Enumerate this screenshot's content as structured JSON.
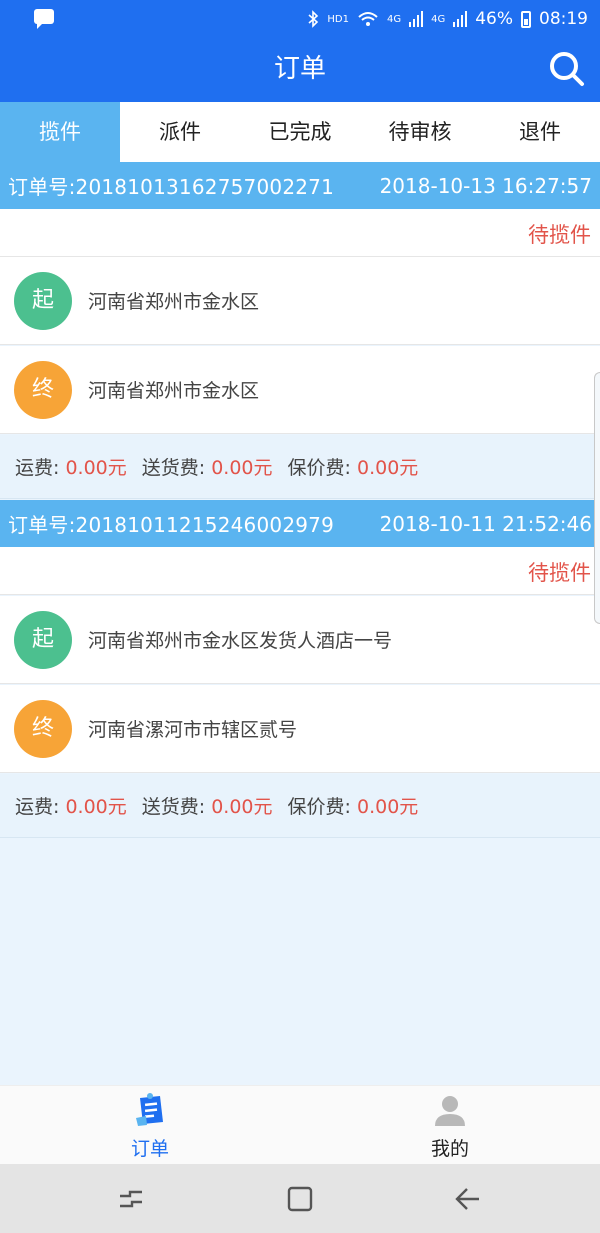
{
  "status_bar": {
    "hd": "HD1",
    "net1": "4G",
    "net2": "4G",
    "battery": "46%",
    "time": "08:19"
  },
  "header": {
    "title": "订单"
  },
  "tabs": [
    {
      "label": "揽件",
      "active": true
    },
    {
      "label": "派件",
      "active": false
    },
    {
      "label": "已完成",
      "active": false
    },
    {
      "label": "待审核",
      "active": false
    },
    {
      "label": "退件",
      "active": false
    }
  ],
  "orders": [
    {
      "number": "订单号:20181013162757002271",
      "datetime": "2018-10-13 16:27:57",
      "state": "待揽件",
      "start_badge": "起",
      "start_address": "河南省郑州市金水区",
      "end_badge": "终",
      "end_address": "河南省郑州市金水区",
      "fees": {
        "freight_label": "运费:",
        "freight_value": "0.00元",
        "delivery_label": "送货费:",
        "delivery_value": "0.00元",
        "insurance_label": "保价费:",
        "insurance_value": "0.00元"
      }
    },
    {
      "number": "订单号:20181011215246002979",
      "datetime": "2018-10-11 21:52:46",
      "state": "待揽件",
      "start_badge": "起",
      "start_address": "河南省郑州市金水区发货人酒店一号",
      "end_badge": "终",
      "end_address": "河南省漯河市市辖区贰号",
      "fees": {
        "freight_label": "运费:",
        "freight_value": "0.00元",
        "delivery_label": "送货费:",
        "delivery_value": "0.00元",
        "insurance_label": "保价费:",
        "insurance_value": "0.00元"
      }
    }
  ],
  "bottom_nav": [
    {
      "label": "订单",
      "icon": "orders-icon",
      "active": true
    },
    {
      "label": "我的",
      "icon": "user-icon",
      "active": false
    }
  ],
  "colors": {
    "primary": "#1f6ff0",
    "tab_active": "#5ab4f0",
    "price": "#e2544a",
    "start_badge": "#4cc08f",
    "end_badge": "#f7a437"
  }
}
